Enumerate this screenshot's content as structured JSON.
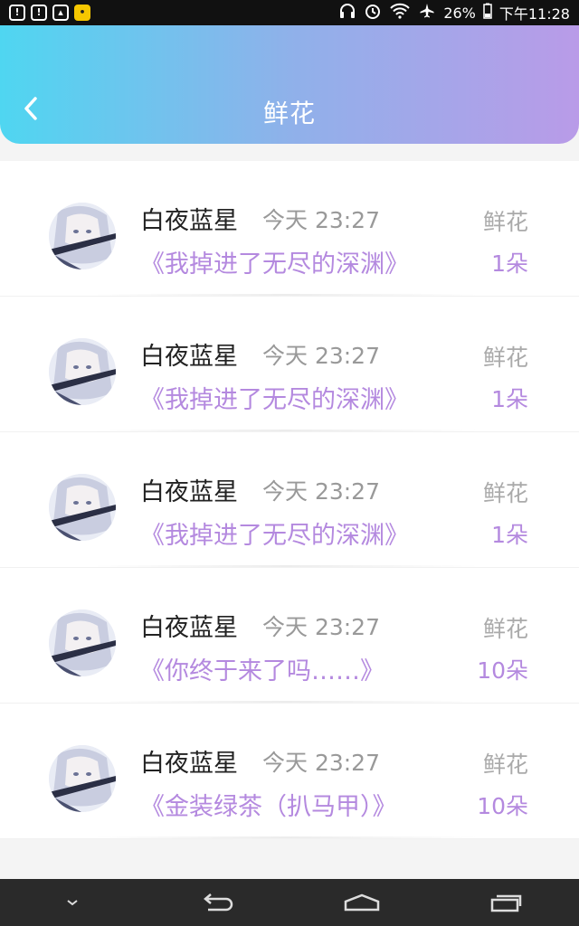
{
  "status_bar": {
    "left_icons": [
      "notification-icon",
      "notification-icon",
      "image-icon",
      "chat-app-icon"
    ],
    "right_icons": [
      "headphones-icon",
      "alarm-icon",
      "wifi-icon",
      "airplane-icon"
    ],
    "battery": "26%",
    "time": "下午11:28"
  },
  "header": {
    "title": "鲜花",
    "back_icon": "chevron-left-icon",
    "gradient_colors": [
      "#4fd6f1",
      "#b99be8"
    ]
  },
  "records": [
    {
      "name": "白夜蓝星",
      "time": "今天 23:27",
      "book": "《我掉进了无尽的深渊》",
      "label": "鲜花",
      "count": "1朵"
    },
    {
      "name": "白夜蓝星",
      "time": "今天 23:27",
      "book": "《我掉进了无尽的深渊》",
      "label": "鲜花",
      "count": "1朵"
    },
    {
      "name": "白夜蓝星",
      "time": "今天 23:27",
      "book": "《我掉进了无尽的深渊》",
      "label": "鲜花",
      "count": "1朵"
    },
    {
      "name": "白夜蓝星",
      "time": "今天 23:27",
      "book": "《你终于来了吗……》",
      "label": "鲜花",
      "count": "10朵"
    },
    {
      "name": "白夜蓝星",
      "time": "今天 23:27",
      "book": "《金装绿茶（扒马甲）》",
      "label": "鲜花",
      "count": "10朵"
    }
  ],
  "colors": {
    "accent_purple": "#b489df",
    "secondary_text": "#999999"
  },
  "nav_bar": {
    "icons": [
      "chevron-down-icon",
      "back-icon",
      "home-icon",
      "recents-icon"
    ]
  }
}
